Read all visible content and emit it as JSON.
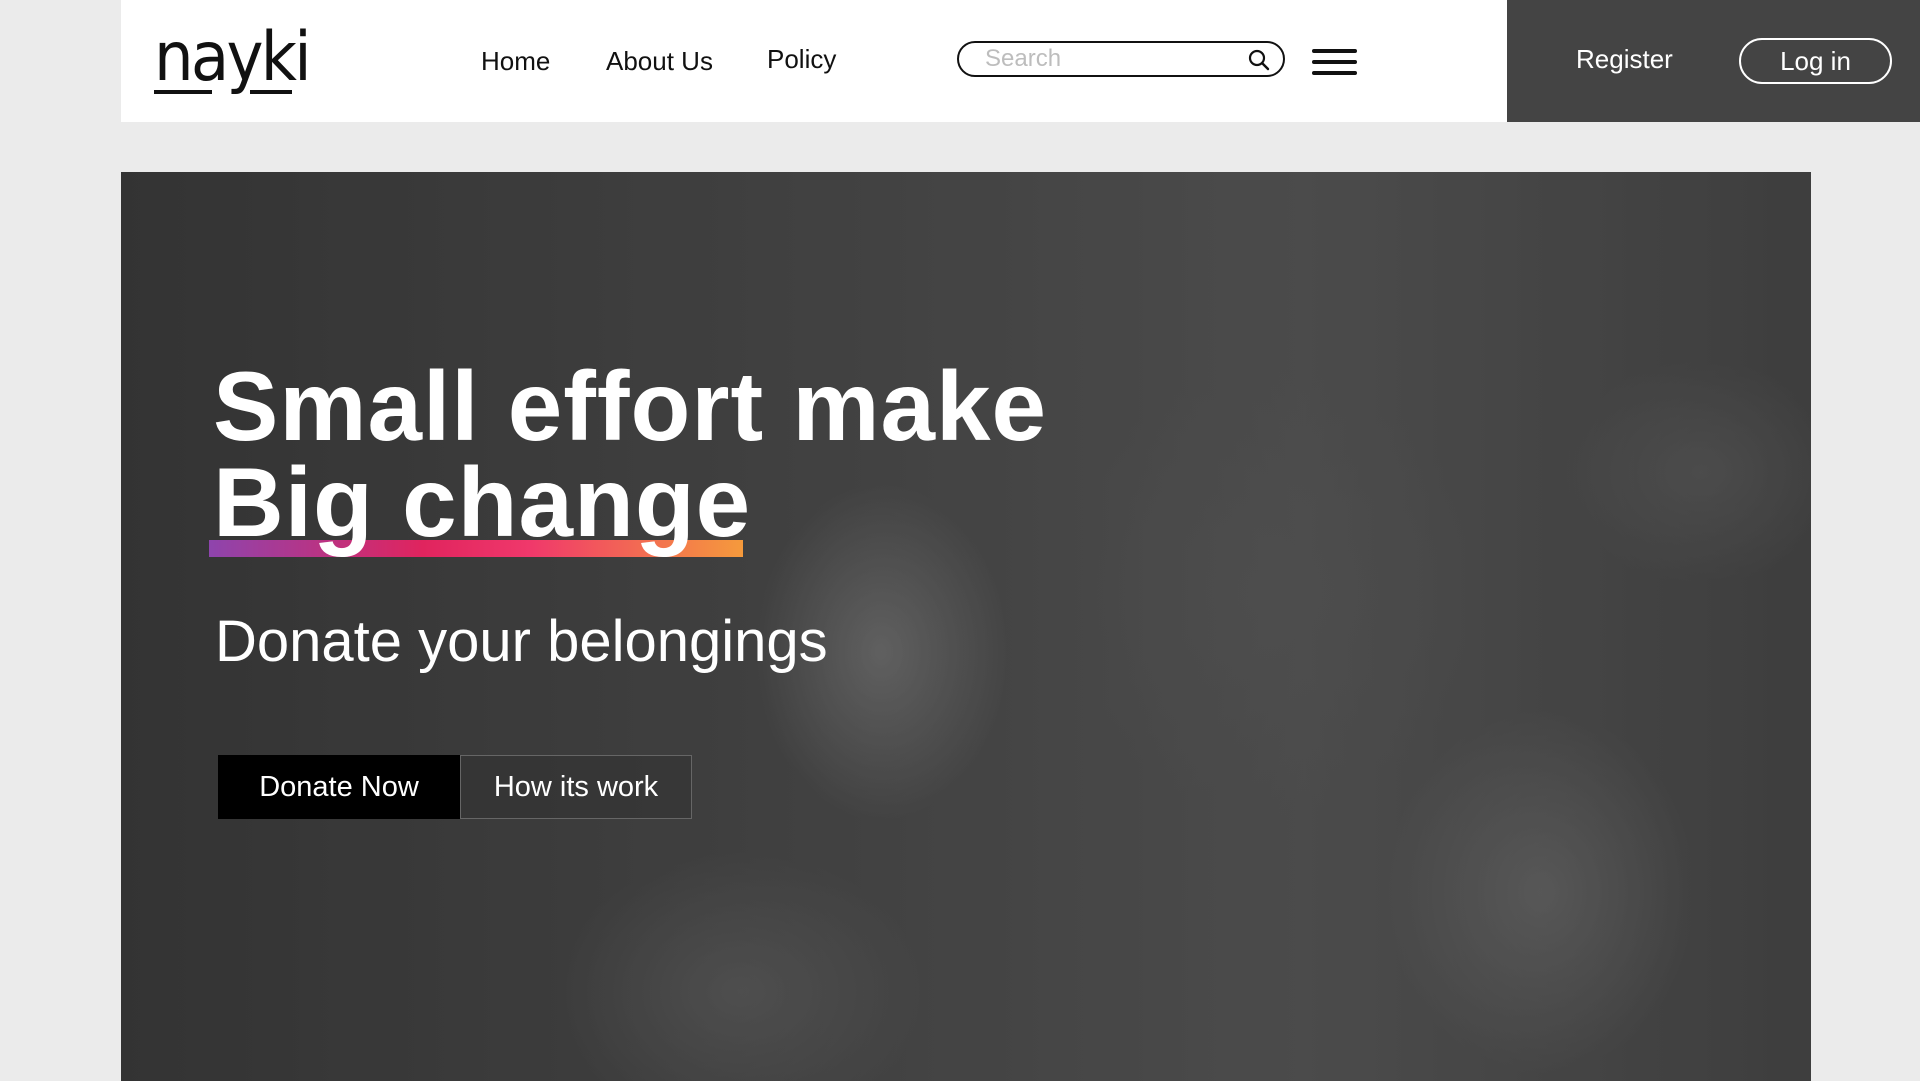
{
  "header": {
    "logo_text": "nayki",
    "nav": [
      {
        "label": "Home"
      },
      {
        "label": "About Us"
      },
      {
        "label": "Policy"
      }
    ],
    "search": {
      "placeholder": "Search",
      "value": ""
    },
    "icons": {
      "search": "search-icon",
      "menu": "hamburger-menu-icon"
    },
    "register_label": "Register",
    "login_label": "Log in"
  },
  "hero": {
    "title_line1": "Small effort make",
    "title_line2": "Big change",
    "subtitle": "Donate your belongings",
    "primary_cta": "Donate Now",
    "secondary_cta": "How its work"
  },
  "colors": {
    "page_background": "#ebebeb",
    "auth_panel": "#444444",
    "underline_gradient": [
      "#8e44ad",
      "#e0245e",
      "#f0386b",
      "#f59a3c"
    ]
  }
}
